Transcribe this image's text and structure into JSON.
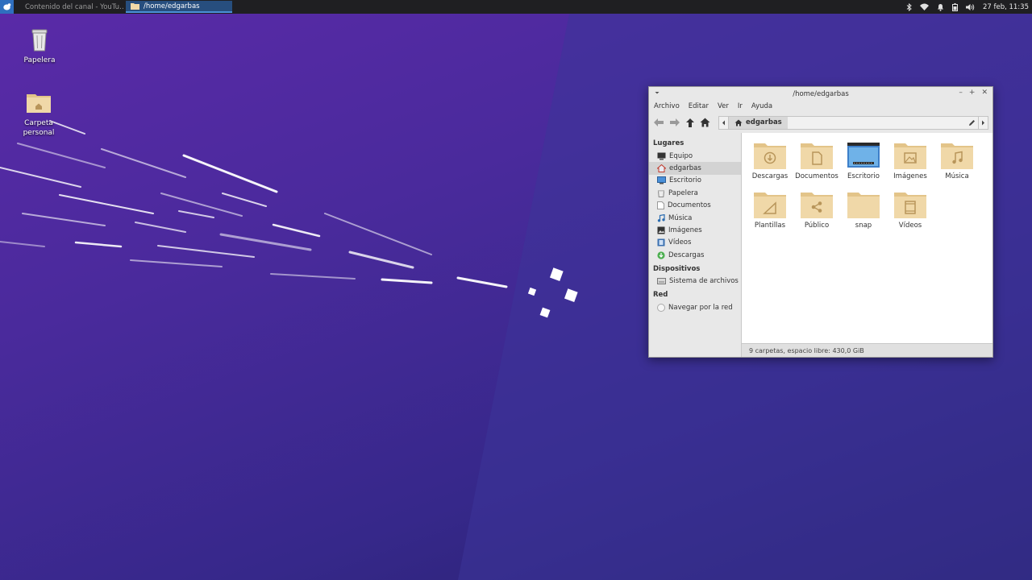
{
  "taskbar": {
    "tasks": [
      {
        "label": "Contenido del canal - YouTu…"
      },
      {
        "label": "/home/edgarbas"
      }
    ],
    "clock": "27 feb, 11:35"
  },
  "desktop": {
    "icons": [
      {
        "label": "Papelera"
      },
      {
        "label": "Carpeta personal"
      }
    ]
  },
  "window": {
    "title": "/home/edgarbas",
    "menu": [
      "Archivo",
      "Editar",
      "Ver",
      "Ir",
      "Ayuda"
    ],
    "path": {
      "crumb": "edgarbas"
    },
    "sidebar": {
      "places_heading": "Lugares",
      "places": [
        {
          "label": "Equipo"
        },
        {
          "label": "edgarbas"
        },
        {
          "label": "Escritorio"
        },
        {
          "label": "Papelera"
        },
        {
          "label": "Documentos"
        },
        {
          "label": "Música"
        },
        {
          "label": "Imágenes"
        },
        {
          "label": "Vídeos"
        },
        {
          "label": "Descargas"
        }
      ],
      "devices_heading": "Dispositivos",
      "devices": [
        {
          "label": "Sistema de archivos"
        }
      ],
      "network_heading": "Red",
      "network": [
        {
          "label": "Navegar por la red"
        }
      ]
    },
    "folders": [
      {
        "label": "Descargas",
        "icon": "download-folder-icon"
      },
      {
        "label": "Documentos",
        "icon": "documents-folder-icon"
      },
      {
        "label": "Escritorio",
        "icon": "desktop-folder-icon"
      },
      {
        "label": "Imágenes",
        "icon": "pictures-folder-icon"
      },
      {
        "label": "Música",
        "icon": "music-folder-icon"
      },
      {
        "label": "Plantillas",
        "icon": "templates-folder-icon"
      },
      {
        "label": "Público",
        "icon": "public-folder-icon"
      },
      {
        "label": "snap",
        "icon": "folder-icon"
      },
      {
        "label": "Vídeos",
        "icon": "videos-folder-icon"
      }
    ],
    "status": "9 carpetas, espacio libre: 430,0 GiB"
  },
  "colors": {
    "wallpaper": "#4a2a9c",
    "panel": "#1f1f22",
    "active_task": "#274e7e",
    "folder": "#f0d8a8"
  }
}
